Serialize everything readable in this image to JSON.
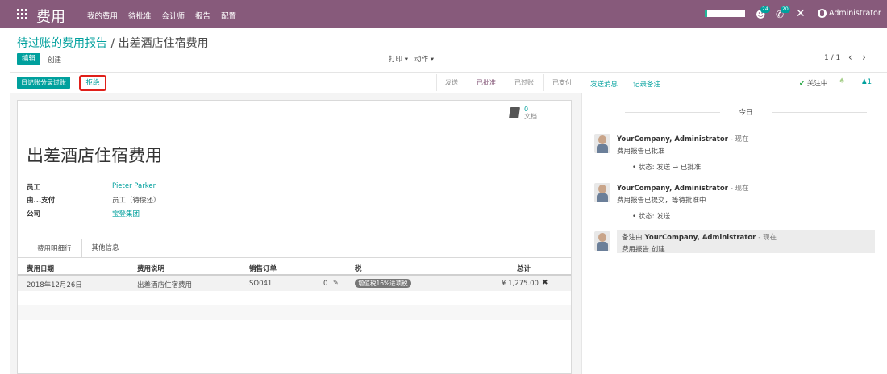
{
  "topbar": {
    "brand": "费用",
    "menu": [
      "我的费用",
      "待批准",
      "会计师",
      "报告",
      "配置"
    ],
    "messages_count": "24",
    "activity_count": "20",
    "user_name": "Administrator",
    "accent_color": "#875a7b"
  },
  "breadcrumb": {
    "parent": "待过账的费用报告",
    "separator": "/",
    "current": "出差酒店住宿费用"
  },
  "control_panel": {
    "edit_label": "编辑",
    "create_label": "创建",
    "print_label": "打印 ▾",
    "action_label": "动作 ▾",
    "pager": "1 / 1",
    "prev_icon": "‹",
    "next_icon": "›"
  },
  "header_buttons": {
    "post_journal_label": "日记账分录过账",
    "refuse_label": "拒绝"
  },
  "statusbar": {
    "stages": [
      {
        "label": "发送",
        "active": false
      },
      {
        "label": "已批准",
        "active": true
      },
      {
        "label": "已过账",
        "active": false
      },
      {
        "label": "已支付",
        "active": false
      }
    ]
  },
  "chatter_top": {
    "send_message": "发送消息",
    "log_note": "记录备注",
    "following": "关注中",
    "followers_count": "1"
  },
  "form": {
    "documents_count": "0",
    "documents_label": "文档",
    "title": "出差酒店住宿费用",
    "fields": [
      {
        "label": "员工",
        "value": "Pieter Parker",
        "link": true
      },
      {
        "label": "由...支付",
        "value": "员工（待偿还）",
        "link": false
      },
      {
        "label": "公司",
        "value": "宝登集团",
        "link": true
      }
    ],
    "tabs": [
      "费用明细行",
      "其他信息"
    ],
    "table": {
      "headers": [
        "费用日期",
        "费用说明",
        "销售订单",
        "税",
        "总计"
      ],
      "rows": [
        {
          "date": "2018年12月26日",
          "description": "出差酒店住宿费用",
          "sale_order": "SO041",
          "attachments": "0",
          "tax": "增值税16%进项税",
          "total": "¥ 1,275.00"
        }
      ]
    }
  },
  "chatter": {
    "day_label": "今日",
    "messages": [
      {
        "author": "YourCompany, Administrator",
        "when": "- 现在",
        "body": "费用报告已批准",
        "tracking": "• 状态: 发送 → 已批准"
      },
      {
        "author": "YourCompany, Administrator",
        "when": "- 现在",
        "body": "费用报告已提交，等待批准中",
        "tracking": "• 状态: 发送"
      }
    ],
    "note": {
      "prefix": "备注由",
      "author": "YourCompany, Administrator",
      "when": "- 现在",
      "body": "费用报告 创建"
    }
  }
}
